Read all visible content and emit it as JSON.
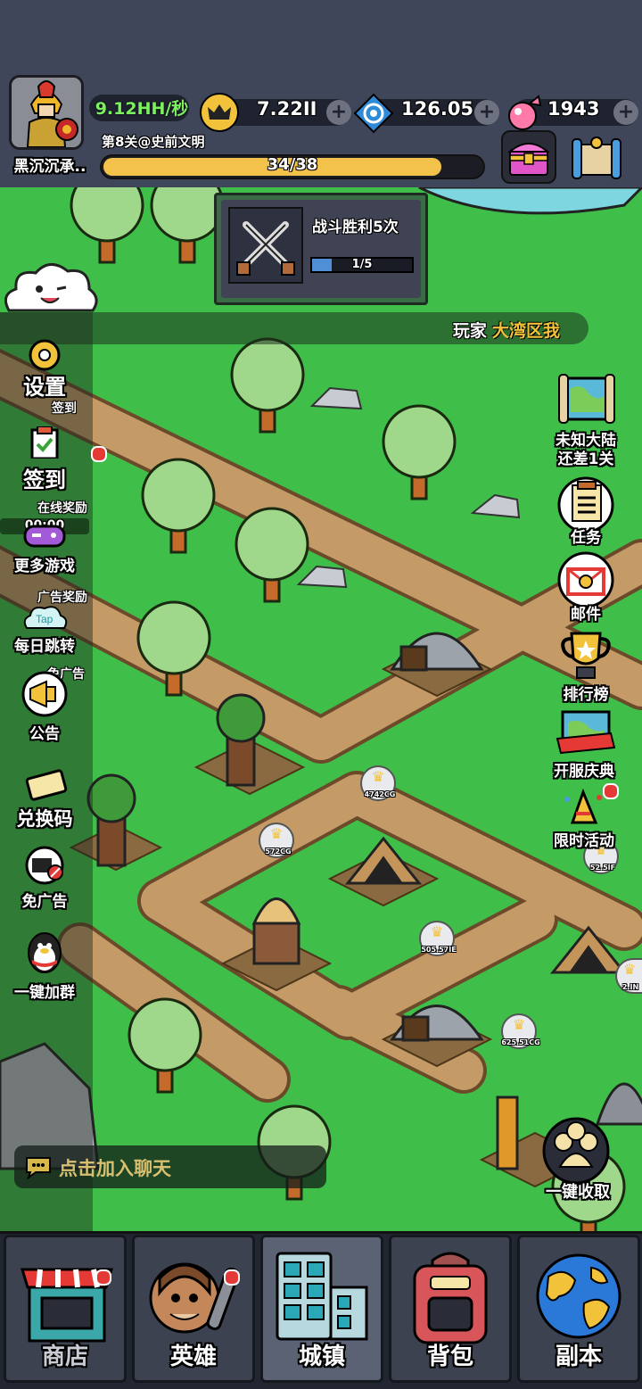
{
  "player": {
    "name": "黑沉沉承..",
    "rate": "9.12HH/秒"
  },
  "resources": {
    "crown": "7.22II",
    "gem": "126.05",
    "candy": "1943"
  },
  "level": {
    "label": "第8关@史前文明",
    "progress_text": "34/38",
    "progress_fraction": 0.895
  },
  "quest": {
    "title": "战斗胜利5次",
    "progress_text": "1/5",
    "progress_fraction": 0.2
  },
  "ticker": {
    "prefix": "玩家",
    "name": "大湾区我"
  },
  "left_menu": [
    {
      "label": "设置",
      "sub": "签到"
    },
    {
      "label": "签到",
      "sub": "在线奖励",
      "timer": "00:00"
    },
    {
      "label": "更多游戏",
      "sub": "广告奖励"
    },
    {
      "label": "每日跳转",
      "sub": "免广告"
    },
    {
      "label": "公告"
    },
    {
      "label": "兑换码"
    },
    {
      "label": "免广告"
    },
    {
      "label": "一键加群"
    }
  ],
  "right_menu": [
    {
      "label": "未知大陆\n还差1关"
    },
    {
      "label": "任务"
    },
    {
      "label": "邮件"
    },
    {
      "label": "排行榜"
    },
    {
      "label": "开服庆典"
    },
    {
      "label": "限时活动"
    }
  ],
  "map_badges": [
    "4742CG",
    "572CG",
    "505.57IE",
    "625.51CG",
    "52.5IF",
    "2.IN"
  ],
  "collect_all": "一键收取",
  "chat_join": "点击加入聊天",
  "bottom_nav": [
    "商店",
    "英雄",
    "城镇",
    "背包",
    "副本"
  ],
  "colors": {
    "grass": "#3fbf4a",
    "path": "#c49a66",
    "progress": "#f3c24b",
    "gold": "#f2c23a"
  }
}
